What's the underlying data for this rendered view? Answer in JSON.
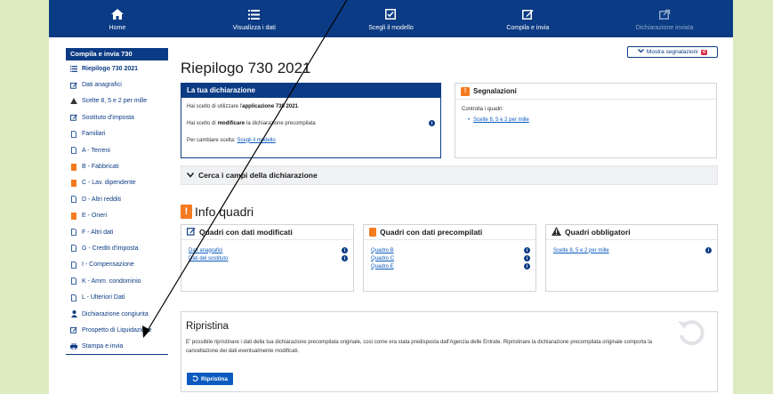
{
  "nav": [
    {
      "label": "Home",
      "icon": "home-icon"
    },
    {
      "label": "Visualizza i dati",
      "icon": "list-icon"
    },
    {
      "label": "Scegli il modello",
      "icon": "checkbox-icon"
    },
    {
      "label": "Compila e invia",
      "icon": "edit-icon"
    },
    {
      "label": "Dichiarazione inviata",
      "icon": "share-icon"
    }
  ],
  "sidebar": {
    "title": "Compila e invia 730",
    "items": [
      {
        "label": "Riepilogo 730 2021",
        "icon": "list-icon"
      },
      {
        "label": "Dati anagrafici",
        "icon": "edit-icon"
      },
      {
        "label": "Scelte 8, 5 e 2 per mille",
        "icon": "warning-icon"
      },
      {
        "label": "Sostituto d'imposta",
        "icon": "edit-icon"
      },
      {
        "label": "Familiari",
        "icon": "document-icon"
      },
      {
        "label": "A - Terreni",
        "icon": "document-icon"
      },
      {
        "label": "B - Fabbricati",
        "icon": "document-orange-icon"
      },
      {
        "label": "C - Lav. dipendente",
        "icon": "document-orange-icon"
      },
      {
        "label": "D - Altri redditi",
        "icon": "document-icon"
      },
      {
        "label": "E - Oneri",
        "icon": "document-orange-icon"
      },
      {
        "label": "F - Altri dati",
        "icon": "document-icon"
      },
      {
        "label": "G - Crediti d'imposta",
        "icon": "document-icon"
      },
      {
        "label": "I - Compensazione",
        "icon": "document-icon"
      },
      {
        "label": "K - Amm. condominio",
        "icon": "document-icon"
      },
      {
        "label": "L - Ulteriori Dati",
        "icon": "document-icon"
      },
      {
        "label": "Dichiarazione congiunta",
        "icon": "user-icon"
      },
      {
        "label": "Prospetto di Liquidazione",
        "icon": "edit-icon"
      },
      {
        "label": "Stampa e invia",
        "icon": "print-icon"
      }
    ]
  },
  "main": {
    "title": "Riepilogo 730 2021",
    "segnalazioni_button": "Mostra segnalazioni",
    "segnalazioni_count": "4",
    "dichiarazione": {
      "header": "La tua dichiarazione",
      "line1_pre": "Hai scelto di utilizzare l'",
      "line1_bold": "applicazione 730 2021",
      "line1_post": ".",
      "line2_pre": "Hai scelto di",
      "line2_bold": "modificare",
      "line2_post": "la dichiarazione precompilata",
      "line3_pre": "Per cambiare scelta:",
      "line3_link": "Scegli il modello"
    },
    "segnalazioni": {
      "header": "Segnalazioni",
      "text": "Controlla i quadri:",
      "items": [
        "Scelte 8, 5 e 2 per mille"
      ]
    },
    "cerca": "Cerca i campi della dichiarazione",
    "info_quadri": "Info quadri",
    "quadri_modificati": {
      "header": "Quadri con dati modificati",
      "items": [
        "Dati anagrafici",
        "Dati del sostituto"
      ]
    },
    "quadri_precompilati": {
      "header": "Quadri con dati precompilati",
      "items": [
        "Quadro B",
        "Quadro C",
        "Quadro E"
      ]
    },
    "quadri_obbligatori": {
      "header": "Quadri obbligatori",
      "items": [
        "Scelte 8, 5 e 2 per mille"
      ]
    },
    "ripristina": {
      "title": "Ripristina",
      "text": "E' possibile ripristinare i dati della tua dichiarazione precompilata originale, così come era stata predisposta dall'Agenzia delle Entrate. Ripristinare la dichiarazione precompilata originale comporta la cancellazione dei dati eventualmente modificati.",
      "button": "Ripristina"
    }
  },
  "colors": {
    "primary": "#0b3b84",
    "accent": "#f47b20",
    "background": "#dcecc0",
    "link": "#0b5bbf"
  }
}
